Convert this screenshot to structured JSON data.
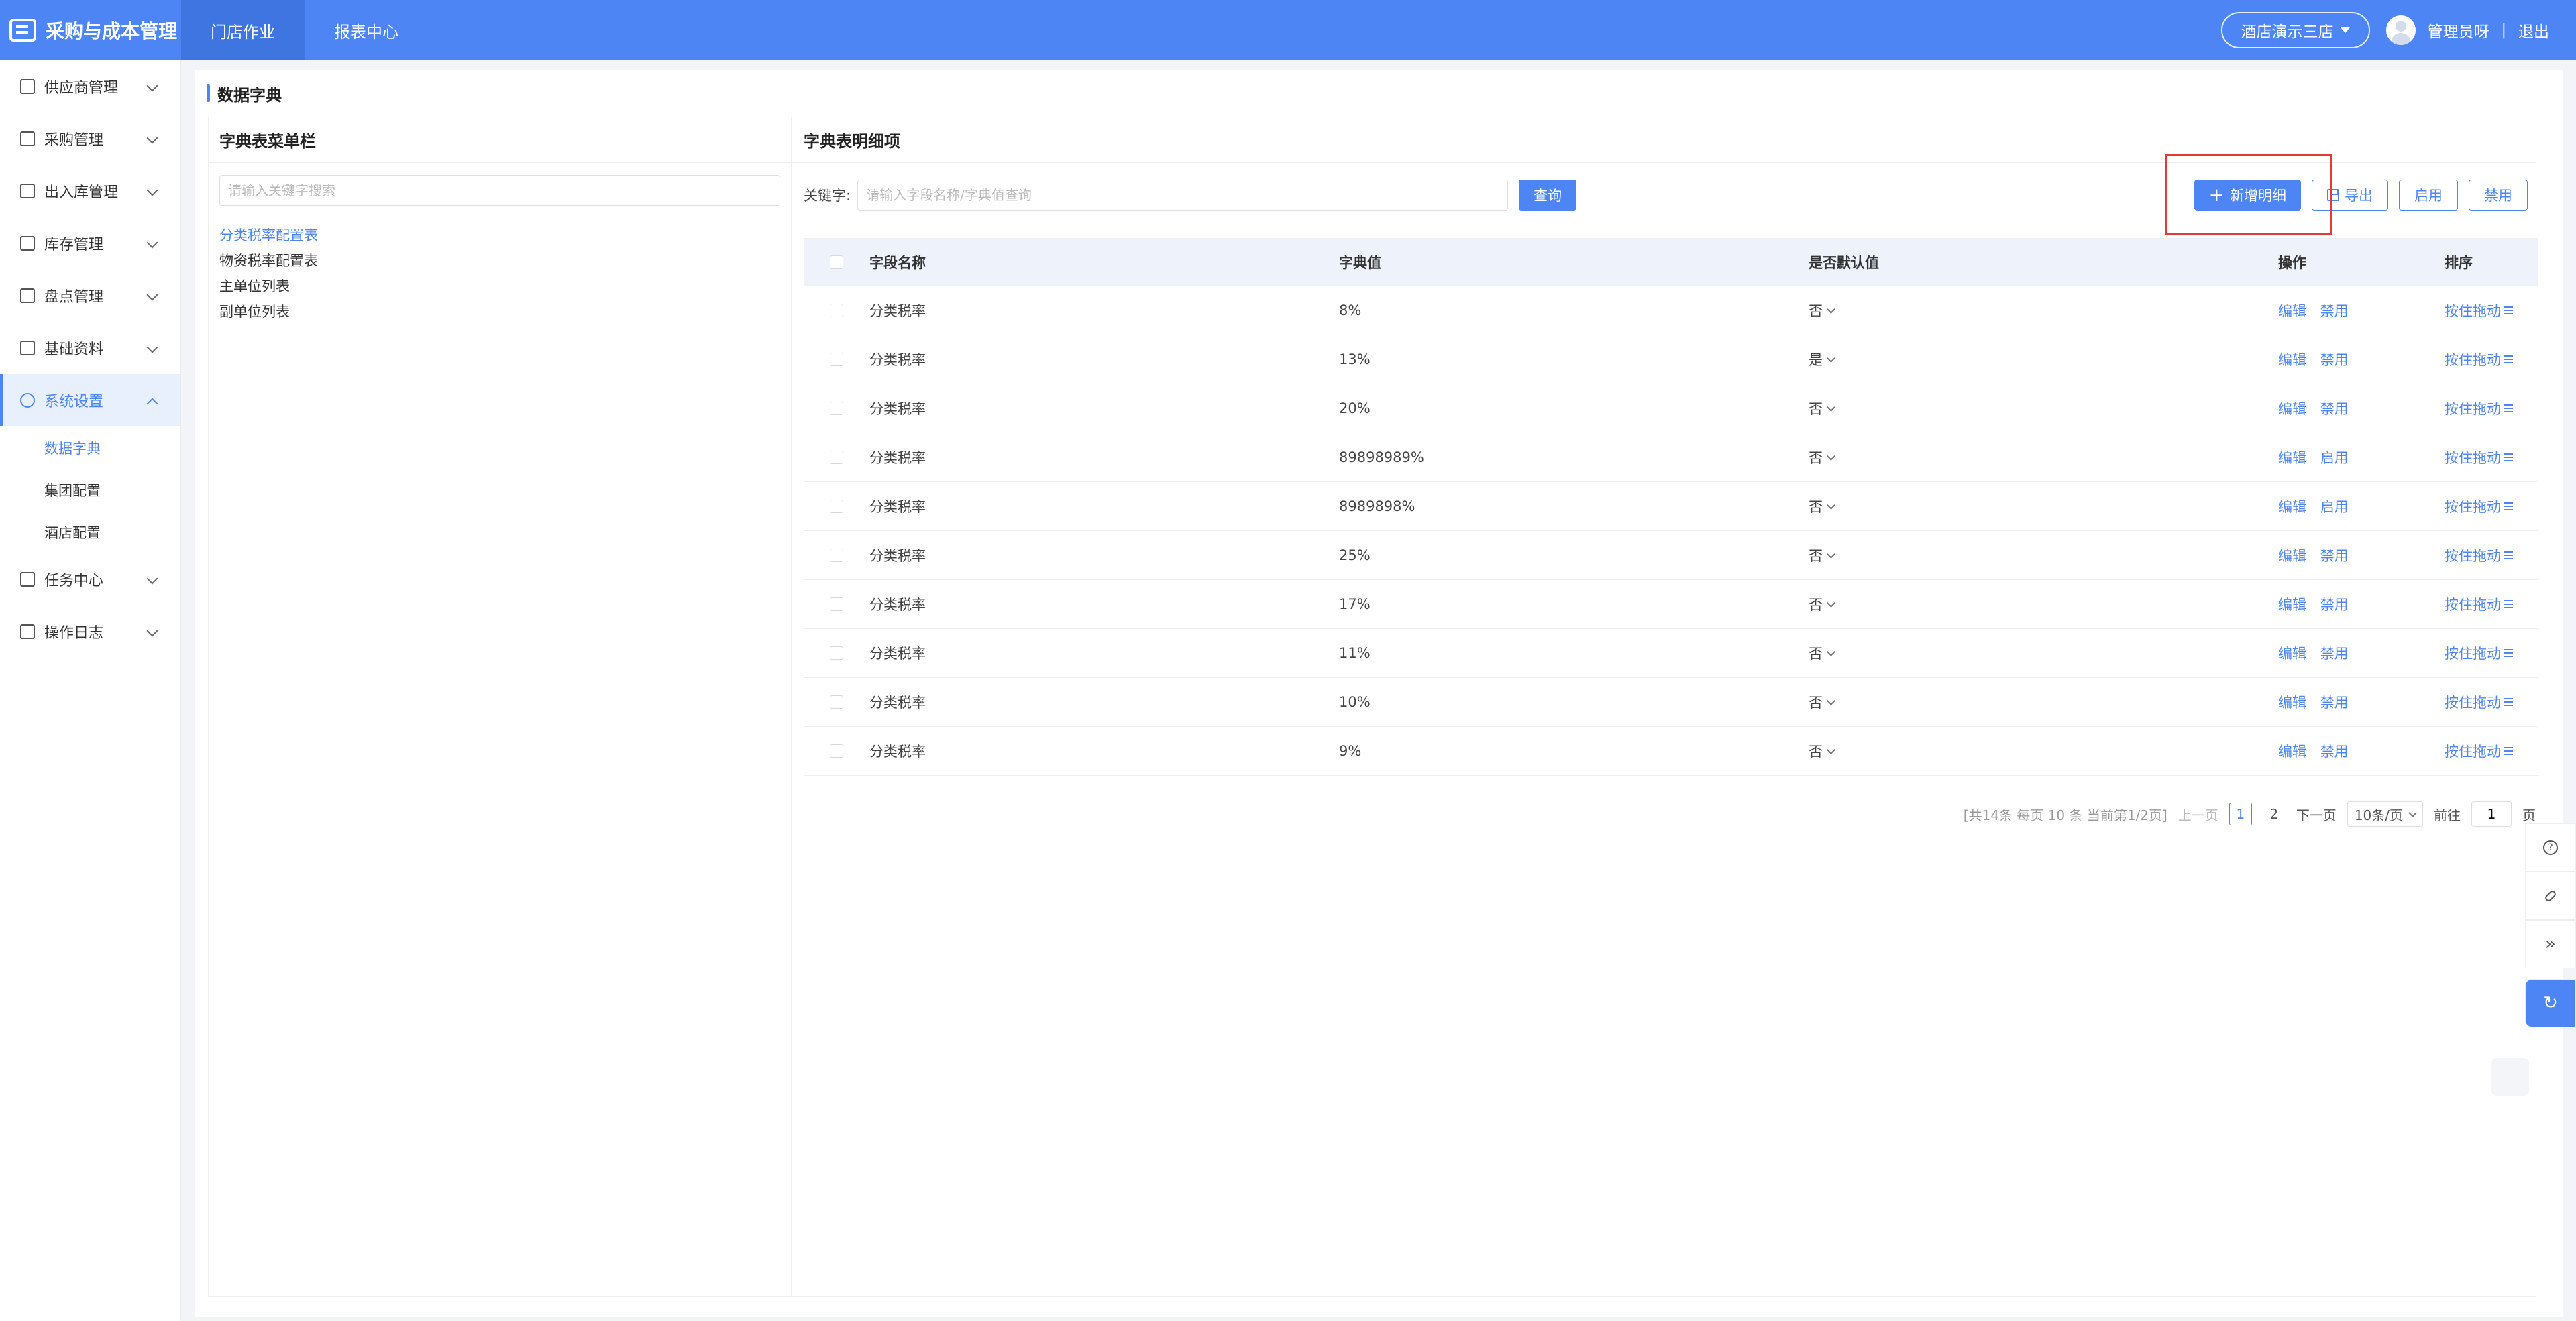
{
  "app": {
    "title": "采购与成本管理",
    "logo_icon": "ledger-icon",
    "accent": "#4d86f4"
  },
  "top_nav": [
    {
      "label": "门店作业",
      "active": true
    },
    {
      "label": "报表中心",
      "active": false
    }
  ],
  "header_right": {
    "store": "酒店演示三店",
    "username": "管理员呀",
    "separator": "|",
    "logout": "退出"
  },
  "sidebar": {
    "items": [
      {
        "label": "供应商管理",
        "icon": "supplier-icon"
      },
      {
        "label": "采购管理",
        "icon": "purchase-icon"
      },
      {
        "label": "出入库管理",
        "icon": "inout-icon"
      },
      {
        "label": "库存管理",
        "icon": "inventory-icon"
      },
      {
        "label": "盘点管理",
        "icon": "stocktake-icon"
      },
      {
        "label": "基础资料",
        "icon": "basic-data-icon"
      },
      {
        "label": "系统设置",
        "icon": "settings-icon",
        "expanded": true
      },
      {
        "label": "任务中心",
        "icon": "task-icon"
      },
      {
        "label": "操作日志",
        "icon": "log-icon"
      }
    ],
    "sub_items": [
      {
        "label": "数据字典",
        "active": true
      },
      {
        "label": "集团配置",
        "active": false
      },
      {
        "label": "酒店配置",
        "active": false
      }
    ]
  },
  "page": {
    "title": "数据字典"
  },
  "left_panel": {
    "title": "字典表菜单栏",
    "search_placeholder": "请输入关键字搜索",
    "tree": [
      {
        "label": "分类税率配置表",
        "active": true
      },
      {
        "label": "物资税率配置表",
        "active": false
      },
      {
        "label": "主单位列表",
        "active": false
      },
      {
        "label": "副单位列表",
        "active": false
      }
    ]
  },
  "right_panel": {
    "title": "字典表明细项",
    "keyword_label": "关键字:",
    "keyword_placeholder": "请输入字段名称/字典值查询",
    "query_label": "查询",
    "add_label": "新增明细",
    "export_label": "导出",
    "enable_label": "启用",
    "disable_label": "禁用"
  },
  "table": {
    "headers": {
      "name": "字段名称",
      "value": "字典值",
      "default": "是否默认值",
      "ops": "操作",
      "sort": "排序"
    },
    "rows": [
      {
        "name": "分类税率",
        "value": "8%",
        "default": "否",
        "edit": "编辑",
        "toggle": "禁用",
        "sort": "按住拖动"
      },
      {
        "name": "分类税率",
        "value": "13%",
        "default": "是",
        "edit": "编辑",
        "toggle": "禁用",
        "sort": "按住拖动"
      },
      {
        "name": "分类税率",
        "value": "20%",
        "default": "否",
        "edit": "编辑",
        "toggle": "禁用",
        "sort": "按住拖动"
      },
      {
        "name": "分类税率",
        "value": "89898989%",
        "default": "否",
        "edit": "编辑",
        "toggle": "启用",
        "sort": "按住拖动"
      },
      {
        "name": "分类税率",
        "value": "8989898%",
        "default": "否",
        "edit": "编辑",
        "toggle": "启用",
        "sort": "按住拖动"
      },
      {
        "name": "分类税率",
        "value": "25%",
        "default": "否",
        "edit": "编辑",
        "toggle": "禁用",
        "sort": "按住拖动"
      },
      {
        "name": "分类税率",
        "value": "17%",
        "default": "否",
        "edit": "编辑",
        "toggle": "禁用",
        "sort": "按住拖动"
      },
      {
        "name": "分类税率",
        "value": "11%",
        "default": "否",
        "edit": "编辑",
        "toggle": "禁用",
        "sort": "按住拖动"
      },
      {
        "name": "分类税率",
        "value": "10%",
        "default": "否",
        "edit": "编辑",
        "toggle": "禁用",
        "sort": "按住拖动"
      },
      {
        "name": "分类税率",
        "value": "9%",
        "default": "否",
        "edit": "编辑",
        "toggle": "禁用",
        "sort": "按住拖动"
      }
    ]
  },
  "pagination": {
    "summary": "[共14条 每页 10 条 当前第1/2页]",
    "prev": "上一页",
    "pages": [
      "1",
      "2"
    ],
    "current": "1",
    "next": "下一页",
    "page_size": "10条/页",
    "goto_label": "前往",
    "goto_value": "1",
    "page_suffix": "页"
  },
  "float_tools": [
    "help-icon",
    "link-icon",
    "double-chevron-icon",
    "refresh-icon"
  ]
}
